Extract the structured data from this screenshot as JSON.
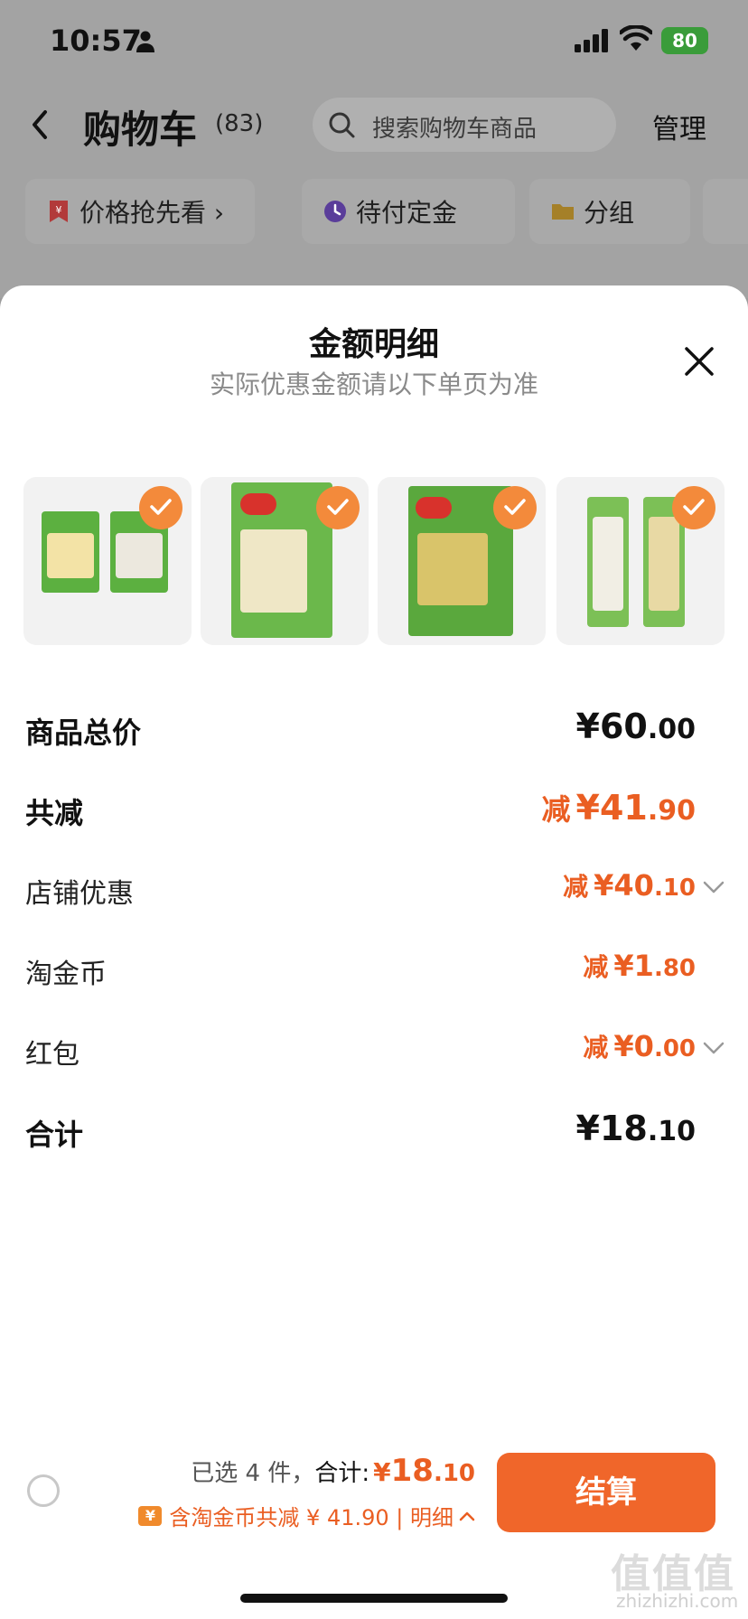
{
  "status_bar": {
    "time": "10:57",
    "battery": "80"
  },
  "nav": {
    "title": "购物车",
    "count": "(83)",
    "search_placeholder": "搜索购物车商品",
    "manage": "管理"
  },
  "filters": [
    {
      "label": "价格抢先看 ›",
      "icon": "price-tag-icon"
    },
    {
      "label": "待付定金",
      "icon": "clock-icon"
    },
    {
      "label": "分组",
      "icon": "folder-icon"
    }
  ],
  "sheet": {
    "title": "金额明细",
    "subtitle": "实际优惠金额请以下单页为准",
    "products": [
      {
        "name": "product-1",
        "selected": true
      },
      {
        "name": "product-2",
        "selected": true
      },
      {
        "name": "product-3",
        "selected": true
      },
      {
        "name": "product-4",
        "selected": true
      }
    ],
    "rows": {
      "total_price": {
        "label": "商品总价",
        "currency": "¥",
        "main": "60",
        "decimal": ".00"
      },
      "total_discount": {
        "label": "共减",
        "prefix": "减",
        "currency": "¥",
        "main": "41",
        "decimal": ".90"
      },
      "shop_discount": {
        "label": "店铺优惠",
        "prefix": "减",
        "currency": "¥",
        "main": "40",
        "decimal": ".10"
      },
      "taobao_coins": {
        "label": "淘金币",
        "prefix": "减",
        "currency": "¥",
        "main": "1",
        "decimal": ".80"
      },
      "red_packet": {
        "label": "红包",
        "prefix": "减",
        "currency": "¥",
        "main": "0",
        "decimal": ".00"
      },
      "grand_total": {
        "label": "合计",
        "currency": "¥",
        "main": "18",
        "decimal": ".10"
      }
    }
  },
  "bottom_bar": {
    "selected_text": "已选 4 件，",
    "total_label": "合计:",
    "currency": "¥",
    "total_main": "18",
    "total_decimal": ".10",
    "coin_icon": "¥",
    "discount_text": "含淘金币共减 ¥ 41.90 | 明细",
    "checkout": "结算"
  },
  "watermark": {
    "text": "值值值",
    "url": "zhizhizhi.com"
  },
  "colors": {
    "accent": "#ea5e22",
    "checkout": "#f0662a",
    "check_badge": "#f38a3b"
  }
}
